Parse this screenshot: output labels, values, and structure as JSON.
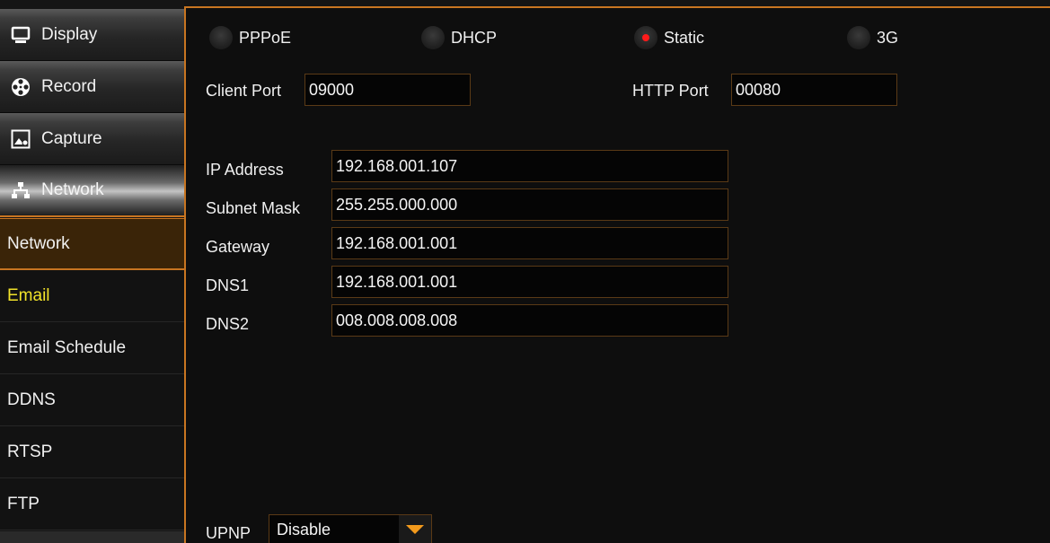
{
  "sidebar": {
    "tabs": [
      {
        "label": "Display",
        "icon": "monitor-icon"
      },
      {
        "label": "Record",
        "icon": "film-reel-icon"
      },
      {
        "label": "Capture",
        "icon": "image-icon"
      },
      {
        "label": "Network",
        "icon": "network-icon"
      }
    ],
    "subitems": [
      {
        "label": "Network"
      },
      {
        "label": "Email"
      },
      {
        "label": "Email Schedule"
      },
      {
        "label": "DDNS"
      },
      {
        "label": "RTSP"
      },
      {
        "label": "FTP"
      }
    ]
  },
  "main": {
    "modes": [
      {
        "label": "PPPoE",
        "selected": false
      },
      {
        "label": "DHCP",
        "selected": false
      },
      {
        "label": "Static",
        "selected": true
      },
      {
        "label": "3G",
        "selected": false
      }
    ],
    "client_port": {
      "label": "Client Port",
      "value": "09000"
    },
    "http_port": {
      "label": "HTTP Port",
      "value": "00080"
    },
    "fields": [
      {
        "label": "IP Address",
        "value": "192.168.001.107"
      },
      {
        "label": "Subnet Mask",
        "value": "255.255.000.000"
      },
      {
        "label": "Gateway",
        "value": "192.168.001.001"
      },
      {
        "label": "DNS1",
        "value": "192.168.001.001"
      },
      {
        "label": "DNS2",
        "value": "008.008.008.008"
      }
    ],
    "upnp": {
      "label": "UPNP",
      "value": "Disable"
    }
  },
  "colors": {
    "accent": "#c87521",
    "highlight": "#f2e32a",
    "radio_on": "#ff1a1a",
    "dropdown_arrow": "#f39a1c"
  }
}
